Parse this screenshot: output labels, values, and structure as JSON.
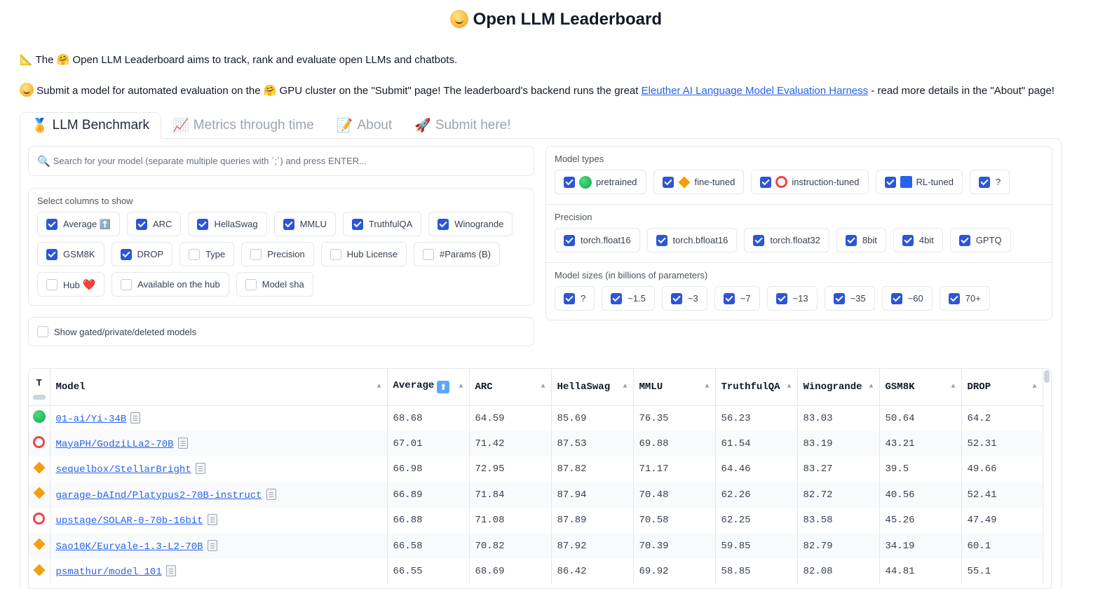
{
  "title": "Open LLM Leaderboard",
  "intro": {
    "line1": "The 🤗 Open LLM Leaderboard aims to track, rank and evaluate open LLMs and chatbots.",
    "line2_pre": "Submit a model for automated evaluation on the 🤗 GPU cluster on the \"Submit\" page! The leaderboard's backend runs the great ",
    "line2_link": "Eleuther AI Language Model Evaluation Harness",
    "line2_post": " - read more details in the \"About\" page!"
  },
  "tabs": [
    {
      "label": "LLM Benchmark",
      "icon": "🏅"
    },
    {
      "label": "Metrics through time",
      "icon": "📈"
    },
    {
      "label": "About",
      "icon": "📝"
    },
    {
      "label": "Submit here!",
      "icon": "🚀"
    }
  ],
  "search": {
    "placeholder": "Search for your model (separate multiple queries with `;`) and press ENTER..."
  },
  "columns_section": {
    "label": "Select columns to show",
    "items": [
      {
        "label": "Average ⬆️",
        "checked": true
      },
      {
        "label": "ARC",
        "checked": true
      },
      {
        "label": "HellaSwag",
        "checked": true
      },
      {
        "label": "MMLU",
        "checked": true
      },
      {
        "label": "TruthfulQA",
        "checked": true
      },
      {
        "label": "Winogrande",
        "checked": true
      },
      {
        "label": "GSM8K",
        "checked": true
      },
      {
        "label": "DROP",
        "checked": true
      },
      {
        "label": "Type",
        "checked": false
      },
      {
        "label": "Precision",
        "checked": false
      },
      {
        "label": "Hub License",
        "checked": false
      },
      {
        "label": "#Params (B)",
        "checked": false
      },
      {
        "label": "Hub",
        "checked": false
      },
      {
        "label": "Available on the hub",
        "checked": false
      },
      {
        "label": "Model sha",
        "checked": false
      }
    ]
  },
  "gated": {
    "label": "Show gated/private/deleted models",
    "checked": false
  },
  "model_types": {
    "label": "Model types",
    "items": [
      {
        "label": "pretrained",
        "icon": "green-circle"
      },
      {
        "label": "fine-tuned",
        "icon": "orange-diamond"
      },
      {
        "label": "instruction-tuned",
        "icon": "red-ring"
      },
      {
        "label": "RL-tuned",
        "icon": "blue-square"
      },
      {
        "label": "?",
        "icon": ""
      }
    ]
  },
  "precision": {
    "label": "Precision",
    "items": [
      "torch.float16",
      "torch.bfloat16",
      "torch.float32",
      "8bit",
      "4bit",
      "GPTQ"
    ]
  },
  "model_sizes": {
    "label": "Model sizes (in billions of parameters)",
    "items": [
      "?",
      "~1.5",
      "~3",
      "~7",
      "~13",
      "~35",
      "~60",
      "70+"
    ]
  },
  "table": {
    "t_header": "T",
    "headers": [
      "Model",
      "Average",
      "ARC",
      "HellaSwag",
      "MMLU",
      "TruthfulQA",
      "Winogrande",
      "GSM8K",
      "DROP"
    ],
    "rows": [
      {
        "type": "green-circle",
        "model": "01-ai/Yi-34B",
        "values": [
          "68.68",
          "64.59",
          "85.69",
          "76.35",
          "56.23",
          "83.03",
          "50.64",
          "64.2"
        ]
      },
      {
        "type": "red-ring",
        "model": "MayaPH/GodziLLa2-70B",
        "values": [
          "67.01",
          "71.42",
          "87.53",
          "69.88",
          "61.54",
          "83.19",
          "43.21",
          "52.31"
        ]
      },
      {
        "type": "orange-diamond",
        "model": "sequelbox/StellarBright",
        "values": [
          "66.98",
          "72.95",
          "87.82",
          "71.17",
          "64.46",
          "83.27",
          "39.5",
          "49.66"
        ]
      },
      {
        "type": "orange-diamond",
        "model": "garage-bAInd/Platypus2-70B-instruct",
        "values": [
          "66.89",
          "71.84",
          "87.94",
          "70.48",
          "62.26",
          "82.72",
          "40.56",
          "52.41"
        ]
      },
      {
        "type": "red-ring",
        "model": "upstage/SOLAR-0-70b-16bit",
        "values": [
          "66.88",
          "71.08",
          "87.89",
          "70.58",
          "62.25",
          "83.58",
          "45.26",
          "47.49"
        ]
      },
      {
        "type": "orange-diamond",
        "model": "Sao10K/Euryale-1.3-L2-70B",
        "values": [
          "66.58",
          "70.82",
          "87.92",
          "70.39",
          "59.85",
          "82.79",
          "34.19",
          "60.1"
        ]
      },
      {
        "type": "orange-diamond",
        "model": "psmathur/model_101",
        "values": [
          "66.55",
          "68.69",
          "86.42",
          "69.92",
          "58.85",
          "82.08",
          "44.81",
          "55.1"
        ]
      }
    ]
  }
}
